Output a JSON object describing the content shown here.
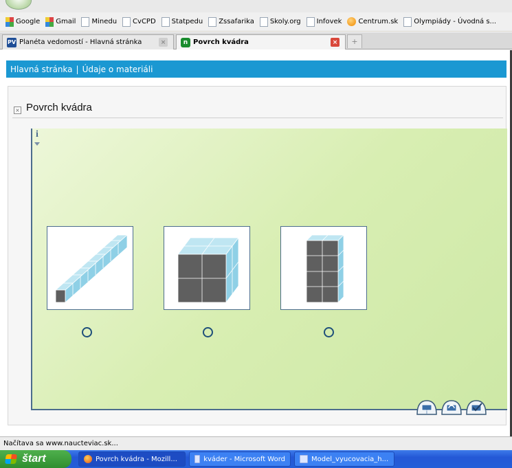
{
  "browser": {
    "bookmarks": [
      {
        "label": "Google",
        "icon": "google"
      },
      {
        "label": "Gmail",
        "icon": "google"
      },
      {
        "label": "Minedu",
        "icon": "page"
      },
      {
        "label": "CvCPD",
        "icon": "page"
      },
      {
        "label": "Statpedu",
        "icon": "page"
      },
      {
        "label": "Zssafarika",
        "icon": "page"
      },
      {
        "label": "Skoly.org",
        "icon": "page"
      },
      {
        "label": "Infovek",
        "icon": "page"
      },
      {
        "label": "Centrum.sk",
        "icon": "orange"
      },
      {
        "label": "Olympiády - Úvodná s...",
        "icon": "page"
      }
    ],
    "tabs": [
      {
        "favicon": "PV",
        "title": "Planéta vedomostí - Hlavná stránka",
        "active": false
      },
      {
        "favicon": "n",
        "title": "Povrch kvádra",
        "active": true
      }
    ],
    "newtab_symbol": "+",
    "status": "Načítava sa www.naucteviac.sk..."
  },
  "site": {
    "nav": {
      "home": "Hlavná stránka",
      "separator": "|",
      "material": "Údaje o materiáli"
    },
    "widget": {
      "title": "Povrch kvádra",
      "close_symbol": "×",
      "info_symbol": "i",
      "options": [
        {
          "shape": "rod",
          "description": "1×1×8"
        },
        {
          "shape": "cube",
          "description": "2×2×2"
        },
        {
          "shape": "tower",
          "description": "2×1×4"
        }
      ],
      "controls": [
        "info-button",
        "reset-button",
        "check-button"
      ]
    },
    "colors": {
      "accent": "#1b98d2",
      "frame": "#4b6c8d",
      "cube_face": "#5f5f5f",
      "cube_side": "#8fd0e6"
    }
  },
  "taskbar": {
    "start": "štart",
    "tasks": [
      {
        "label": "Povrch kvádra - Mozill...",
        "icon": "firefox",
        "active": true
      },
      {
        "label": "kváder - Microsoft Word",
        "icon": "word",
        "active": false
      },
      {
        "label": "Model_vyucovacia_h...",
        "icon": "word",
        "active": false
      }
    ]
  }
}
